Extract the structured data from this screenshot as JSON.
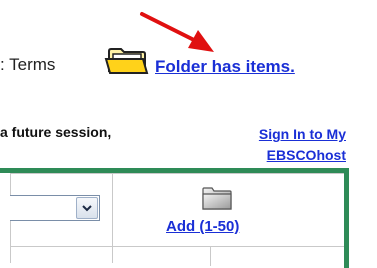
{
  "header": {
    "terms_text": ": Terms",
    "folder_status_link": "Folder has items.",
    "folder_icon": "folder-icon"
  },
  "session": {
    "prompt_text": "a future session,",
    "signin_link": "Sign In to My EBSCOhost"
  },
  "panel": {
    "select_value": "",
    "dropdown_icon": "chevron-down-icon",
    "add_icon": "folder-icon",
    "add_link": "Add (1-50)"
  },
  "colors": {
    "link": "#1a2fd6",
    "panel_border": "#2e8b57",
    "annotation_arrow": "#e01010"
  }
}
